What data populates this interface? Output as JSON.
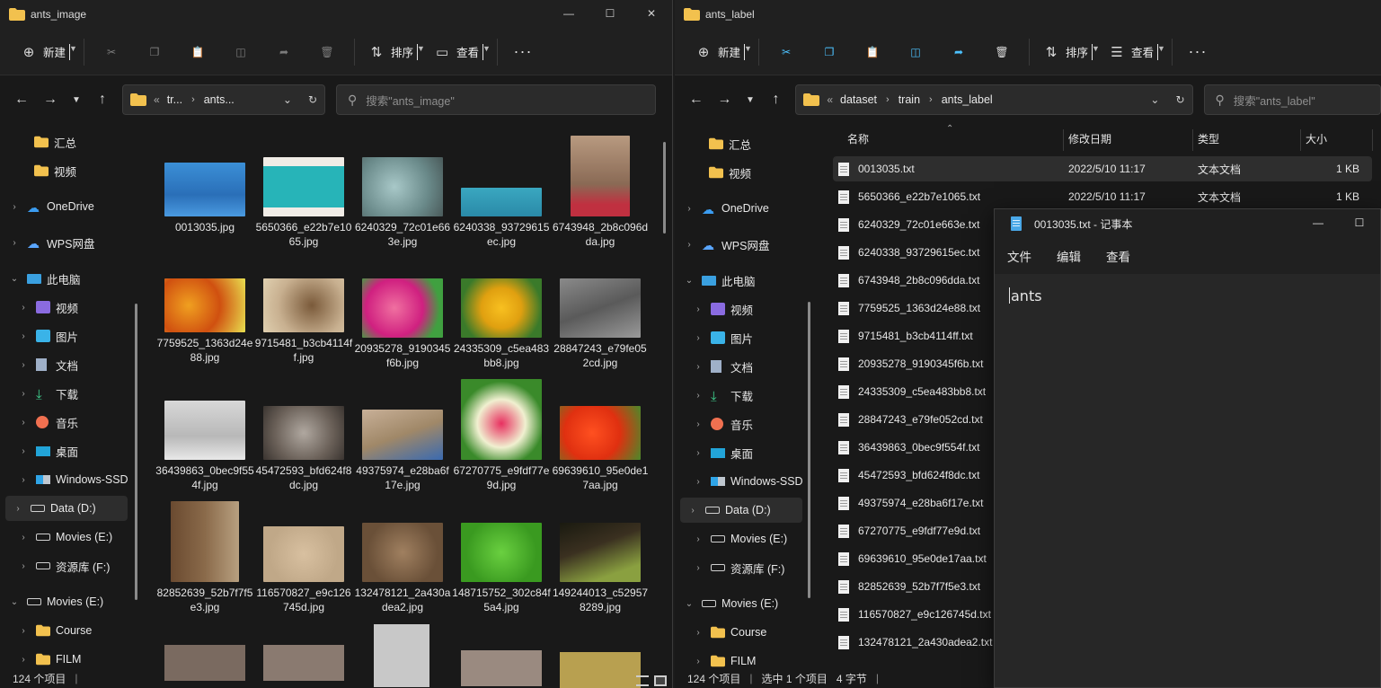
{
  "colors": {
    "accent": "#4cc2ff",
    "folder": "#f2c14e",
    "window_bg": "#191919",
    "selected_row": "#2e2e2e"
  },
  "left_window": {
    "title": "ants_image",
    "toolbar": {
      "new": "新建",
      "sort": "排序",
      "view": "查看"
    },
    "breadcrumb": [
      "tr...",
      "ants..."
    ],
    "search_placeholder": "搜索\"ants_image\"",
    "sidebar": {
      "quick": [
        "汇总",
        "视频"
      ],
      "onedrive": "OneDrive",
      "wps": "WPS网盘",
      "thispc": "此电脑",
      "pc_items": [
        "视频",
        "图片",
        "文档",
        "下载",
        "音乐",
        "桌面",
        "Windows-SSD",
        "Data (D:)",
        "Movies (E:)",
        "资源库 (F:)"
      ],
      "movies_root": "Movies (E:)",
      "movie_folders": [
        "Course",
        "FILM"
      ]
    },
    "thumbnails": [
      "0013035.jpg",
      "5650366_e22b7e1065.jpg",
      "6240329_72c01e663e.jpg",
      "6240338_93729615ec.jpg",
      "6743948_2b8c096dda.jpg",
      "7759525_1363d24e88.jpg",
      "9715481_b3cb4114ff.jpg",
      "20935278_9190345f6b.jpg",
      "24335309_c5ea483bb8.jpg",
      "28847243_e79fe052cd.jpg",
      "36439863_0bec9f554f.jpg",
      "45472593_bfd624f8dc.jpg",
      "49375974_e28ba6f17e.jpg",
      "67270775_e9fdf77e9d.jpg",
      "69639610_95e0de17aa.jpg",
      "82852639_52b7f7f5e3.jpg",
      "116570827_e9c126745d.jpg",
      "132478121_2a430adea2.jpg",
      "148715752_302c84f5a4.jpg",
      "149244013_c529578289.jpg"
    ],
    "status": "124 个项目"
  },
  "right_window": {
    "title": "ants_label",
    "toolbar": {
      "new": "新建",
      "sort": "排序",
      "view": "查看"
    },
    "breadcrumb": [
      "dataset",
      "train",
      "ants_label"
    ],
    "search_placeholder": "搜索\"ants_label\"",
    "columns": {
      "name": "名称",
      "modified": "修改日期",
      "type": "类型",
      "size": "大小"
    },
    "files": [
      {
        "name": "0013035.txt",
        "modified": "2022/5/10 11:17",
        "type": "文本文档",
        "size": "1 KB"
      },
      {
        "name": "5650366_e22b7e1065.txt",
        "modified": "2022/5/10 11:17",
        "type": "文本文档",
        "size": "1 KB"
      },
      {
        "name": "6240329_72c01e663e.txt"
      },
      {
        "name": "6240338_93729615ec.txt"
      },
      {
        "name": "6743948_2b8c096dda.txt"
      },
      {
        "name": "7759525_1363d24e88.txt"
      },
      {
        "name": "9715481_b3cb4114ff.txt"
      },
      {
        "name": "20935278_9190345f6b.txt"
      },
      {
        "name": "24335309_c5ea483bb8.txt"
      },
      {
        "name": "28847243_e79fe052cd.txt"
      },
      {
        "name": "36439863_0bec9f554f.txt"
      },
      {
        "name": "45472593_bfd624f8dc.txt"
      },
      {
        "name": "49375974_e28ba6f17e.txt"
      },
      {
        "name": "67270775_e9fdf77e9d.txt"
      },
      {
        "name": "69639610_95e0de17aa.txt"
      },
      {
        "name": "82852639_52b7f7f5e3.txt"
      },
      {
        "name": "116570827_e9c126745d.txt"
      },
      {
        "name": "132478121_2a430adea2.txt"
      }
    ],
    "status": {
      "count": "124 个项目",
      "selected": "选中 1 个项目",
      "size": "4 字节"
    }
  },
  "notepad": {
    "title": "0013035.txt - 记事本",
    "menu": [
      "文件",
      "编辑",
      "查看"
    ],
    "content": "ants"
  }
}
